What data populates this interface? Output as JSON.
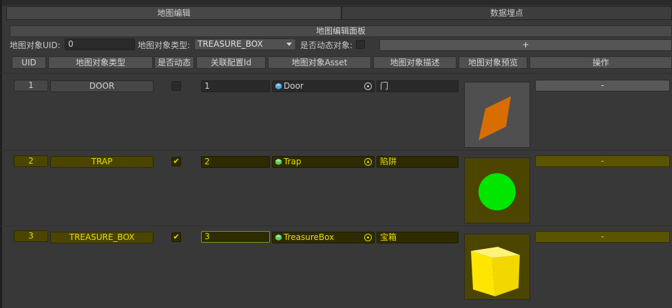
{
  "tabs": [
    {
      "label": "地图编辑"
    },
    {
      "label": "数据埋点"
    }
  ],
  "panel_title": "地图编辑面板",
  "toolbar": {
    "uid_label": "地图对象UID:",
    "uid_value": "0",
    "type_label": "地图对象类型:",
    "type_value": "TREASURE_BOX",
    "dynamic_label": "是否动态对象:",
    "add_button": "+"
  },
  "columns": [
    "UID",
    "地图对象类型",
    "是否动态",
    "关联配置Id",
    "地图对象Asset",
    "地图对象描述",
    "地图对象预览",
    "操作"
  ],
  "rows": [
    {
      "uid": "1",
      "type": "DOOR",
      "dynamic": "",
      "config_id": "1",
      "asset": "Door",
      "asset_icon_color": "#4aa8e8",
      "description": "门",
      "remove": "-",
      "highlight": false
    },
    {
      "uid": "2",
      "type": "TRAP",
      "dynamic": "✔",
      "config_id": "2",
      "asset": "Trap",
      "asset_icon_color": "#5ec85e",
      "description": "陷阱",
      "remove": "-",
      "highlight": true
    },
    {
      "uid": "3",
      "type": "TREASURE_BOX",
      "dynamic": "✔",
      "config_id": "3",
      "asset": "TreasureBox",
      "asset_icon_color": "#5ec85e",
      "description": "宝箱",
      "remove": "-",
      "highlight": true
    }
  ],
  "colors": {
    "accent_yellow": "#e8de00",
    "preview_door": "#d96e00",
    "preview_trap": "#00e600",
    "preview_box": "#ffe600"
  }
}
